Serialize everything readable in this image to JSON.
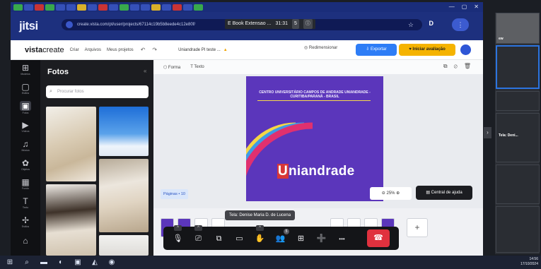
{
  "browser": {
    "url": "create.vista.com/pt/user/projects/67114c19b5b8eede4c12e80f/",
    "title_chip": "E Book Extensao ...",
    "time": "31:31",
    "participants_badge": "5"
  },
  "jitsi": {
    "logo": "jitsi"
  },
  "vistacreate": {
    "logo_bold": "vista",
    "logo_regular": "create",
    "menu": [
      "Criar",
      "Arquivos",
      "Meus projetos"
    ],
    "doc_name": "Uniandrade PI teste ...",
    "resize_label": "Redimensionar",
    "export_label": "Exportar",
    "review_label": "Iniciar avaliação"
  },
  "rail": [
    {
      "label": "Modelos",
      "icon": "grid-icon",
      "glyph": "⊞"
    },
    {
      "label": "Estilos",
      "icon": "styles-icon",
      "glyph": "▢"
    },
    {
      "label": "Fotos",
      "icon": "photo-icon",
      "glyph": "▣",
      "active": true
    },
    {
      "label": "Vídeos",
      "icon": "video-icon",
      "glyph": "▶"
    },
    {
      "label": "Música",
      "icon": "music-icon",
      "glyph": "♫"
    },
    {
      "label": "Objetos",
      "icon": "objects-icon",
      "glyph": "✿"
    },
    {
      "label": "Fundo",
      "icon": "background-icon",
      "glyph": "▦"
    },
    {
      "label": "Texto",
      "icon": "text-icon",
      "glyph": "T"
    },
    {
      "label": "Estilos",
      "icon": "effects-icon",
      "glyph": "✢"
    },
    {
      "label": "",
      "icon": "more-icon",
      "glyph": "⌂"
    }
  ],
  "panel": {
    "title": "Fotos",
    "search_placeholder": "Procurar fotos"
  },
  "canvas_tools": {
    "forma": "Forma",
    "texto": "Texto"
  },
  "design": {
    "heading": "CENTRO UNIVERSITÁRIO CAMPOS DE ANDRADE UNIANDRADE - CURITIBA/PARANÁ - BRASIL",
    "brand_first": "U",
    "brand_rest": "niandrade"
  },
  "pages_label": "Páginas • 10",
  "zoom_value": "25%",
  "help_label": "Central de ajuda",
  "speaker_label": "Tela: Denise Maria D. de Lucena",
  "add_page": "+",
  "filmstrip": {
    "screen_tile_label": "Tela: Deni...",
    "user_initials": "ew"
  },
  "toolbox": [
    {
      "icon": "microphone-icon",
      "glyph": "🎙",
      "caret": true
    },
    {
      "icon": "camera-icon",
      "glyph": "⎚",
      "caret": true
    },
    {
      "icon": "screen-share-icon",
      "glyph": "⧉"
    },
    {
      "icon": "chat-icon",
      "glyph": "▭"
    },
    {
      "icon": "raise-hand-icon",
      "glyph": "✋",
      "caret": true
    },
    {
      "icon": "participants-icon",
      "glyph": "👥",
      "count": "5"
    },
    {
      "icon": "tile-view-icon",
      "glyph": "⊞"
    },
    {
      "icon": "invite-icon",
      "glyph": "➕"
    },
    {
      "icon": "more-actions-icon",
      "glyph": "•••"
    }
  ],
  "hangup_glyph": "☎",
  "clock": {
    "time": "14:56",
    "date": "17/10/2024"
  },
  "colors": {
    "jitsi_blue": "#1d307e",
    "export_blue": "#2e7df6",
    "review_yellow": "#f5b300",
    "design_purple": "#5b36bb",
    "hangup_red": "#e0313e"
  }
}
